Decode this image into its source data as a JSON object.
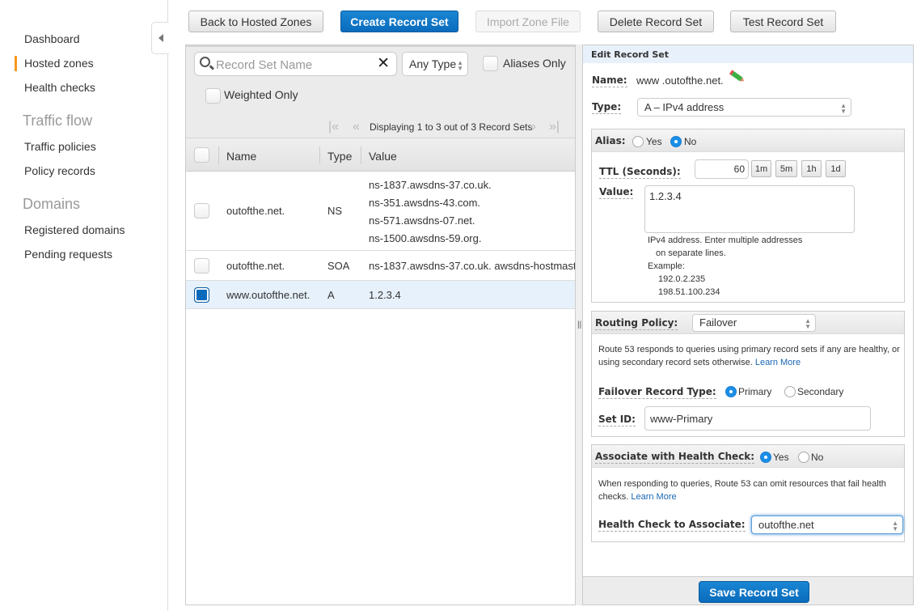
{
  "sidebar": {
    "items": [
      {
        "label": "Dashboard",
        "active": false
      },
      {
        "label": "Hosted zones",
        "active": true
      },
      {
        "label": "Health checks",
        "active": false
      }
    ],
    "traffic_flow": {
      "heading": "Traffic flow",
      "items": [
        {
          "label": "Traffic policies"
        },
        {
          "label": "Policy records"
        }
      ]
    },
    "domains": {
      "heading": "Domains",
      "items": [
        {
          "label": "Registered domains"
        },
        {
          "label": "Pending requests"
        }
      ]
    },
    "collapse_icon": "triangle-left-icon"
  },
  "toolbar": {
    "back": "Back to Hosted Zones",
    "create": "Create Record Set",
    "import": "Import Zone File",
    "delete": "Delete Record Set",
    "test": "Test Record Set"
  },
  "filters": {
    "search_placeholder": "Record Set Name",
    "search_value": "",
    "type_select": "Any Type",
    "aliases_only": {
      "label": "Aliases Only",
      "checked": false
    },
    "weighted_only": {
      "label": "Weighted Only",
      "checked": false
    },
    "pager_text": "Displaying 1 to 3 out of 3 Record Sets"
  },
  "table": {
    "columns": [
      "Name",
      "Type",
      "Value"
    ],
    "rows": [
      {
        "name": "outofthe.net.",
        "type": "NS",
        "values": [
          "ns-1837.awsdns-37.co.uk.",
          "ns-351.awsdns-43.com.",
          "ns-571.awsdns-07.net.",
          "ns-1500.awsdns-59.org."
        ],
        "selected": false
      },
      {
        "name": "outofthe.net.",
        "type": "SOA",
        "values": [
          "ns-1837.awsdns-37.co.uk. awsdns-hostmast"
        ],
        "selected": false
      },
      {
        "name": "www.outofthe.net.",
        "type": "A",
        "values": [
          "1.2.3.4"
        ],
        "selected": true
      }
    ]
  },
  "edit": {
    "title": "Edit Record Set",
    "name_label": "Name:",
    "name_value": "www .outofthe.net.",
    "type_label": "Type:",
    "type_value": "A – IPv4 address",
    "alias_label": "Alias:",
    "alias_yes": "Yes",
    "alias_no": "No",
    "alias_selected": "No",
    "ttl_label": "TTL (Seconds):",
    "ttl_value": "60",
    "ttl_presets": [
      "1m",
      "5m",
      "1h",
      "1d"
    ],
    "value_label": "Value:",
    "value_text": "1.2.3.4",
    "value_help": [
      "IPv4 address. Enter multiple addresses",
      "on separate lines.",
      "Example:",
      "192.0.2.235",
      "198.51.100.234"
    ],
    "routing_label": "Routing Policy:",
    "routing_value": "Failover",
    "routing_help": "Route 53 responds to queries using primary record sets if any are healthy, or using secondary record sets otherwise.",
    "learn_more": "Learn More",
    "failover_label": "Failover Record Type:",
    "failover_primary": "Primary",
    "failover_secondary": "Secondary",
    "failover_selected": "Primary",
    "setid_label": "Set ID:",
    "setid_value": "www-Primary",
    "hc_label": "Associate with Health Check:",
    "hc_yes": "Yes",
    "hc_no": "No",
    "hc_selected": "Yes",
    "hc_help": "When responding to queries, Route 53 can omit resources that fail health checks.",
    "hc_assoc_label": "Health Check to Associate:",
    "hc_assoc_value": "outofthe.net",
    "save": "Save Record Set"
  },
  "colors": {
    "accent_blue": "#0a6bbd",
    "active_nav": "#f7981d",
    "selected_row": "#e6f1fb",
    "link": "#1a66b3"
  }
}
